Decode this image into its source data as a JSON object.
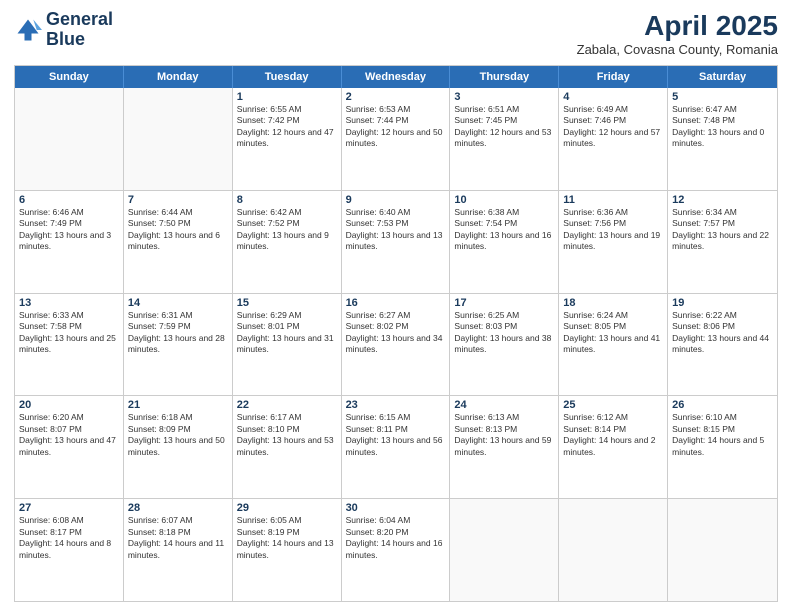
{
  "header": {
    "logo_line1": "General",
    "logo_line2": "Blue",
    "title": "April 2025",
    "subtitle": "Zabala, Covasna County, Romania"
  },
  "weekdays": [
    "Sunday",
    "Monday",
    "Tuesday",
    "Wednesday",
    "Thursday",
    "Friday",
    "Saturday"
  ],
  "rows": [
    [
      {
        "day": "",
        "text": "",
        "empty": true
      },
      {
        "day": "",
        "text": "",
        "empty": true
      },
      {
        "day": "1",
        "text": "Sunrise: 6:55 AM\nSunset: 7:42 PM\nDaylight: 12 hours and 47 minutes."
      },
      {
        "day": "2",
        "text": "Sunrise: 6:53 AM\nSunset: 7:44 PM\nDaylight: 12 hours and 50 minutes."
      },
      {
        "day": "3",
        "text": "Sunrise: 6:51 AM\nSunset: 7:45 PM\nDaylight: 12 hours and 53 minutes."
      },
      {
        "day": "4",
        "text": "Sunrise: 6:49 AM\nSunset: 7:46 PM\nDaylight: 12 hours and 57 minutes."
      },
      {
        "day": "5",
        "text": "Sunrise: 6:47 AM\nSunset: 7:48 PM\nDaylight: 13 hours and 0 minutes."
      }
    ],
    [
      {
        "day": "6",
        "text": "Sunrise: 6:46 AM\nSunset: 7:49 PM\nDaylight: 13 hours and 3 minutes."
      },
      {
        "day": "7",
        "text": "Sunrise: 6:44 AM\nSunset: 7:50 PM\nDaylight: 13 hours and 6 minutes."
      },
      {
        "day": "8",
        "text": "Sunrise: 6:42 AM\nSunset: 7:52 PM\nDaylight: 13 hours and 9 minutes."
      },
      {
        "day": "9",
        "text": "Sunrise: 6:40 AM\nSunset: 7:53 PM\nDaylight: 13 hours and 13 minutes."
      },
      {
        "day": "10",
        "text": "Sunrise: 6:38 AM\nSunset: 7:54 PM\nDaylight: 13 hours and 16 minutes."
      },
      {
        "day": "11",
        "text": "Sunrise: 6:36 AM\nSunset: 7:56 PM\nDaylight: 13 hours and 19 minutes."
      },
      {
        "day": "12",
        "text": "Sunrise: 6:34 AM\nSunset: 7:57 PM\nDaylight: 13 hours and 22 minutes."
      }
    ],
    [
      {
        "day": "13",
        "text": "Sunrise: 6:33 AM\nSunset: 7:58 PM\nDaylight: 13 hours and 25 minutes."
      },
      {
        "day": "14",
        "text": "Sunrise: 6:31 AM\nSunset: 7:59 PM\nDaylight: 13 hours and 28 minutes."
      },
      {
        "day": "15",
        "text": "Sunrise: 6:29 AM\nSunset: 8:01 PM\nDaylight: 13 hours and 31 minutes."
      },
      {
        "day": "16",
        "text": "Sunrise: 6:27 AM\nSunset: 8:02 PM\nDaylight: 13 hours and 34 minutes."
      },
      {
        "day": "17",
        "text": "Sunrise: 6:25 AM\nSunset: 8:03 PM\nDaylight: 13 hours and 38 minutes."
      },
      {
        "day": "18",
        "text": "Sunrise: 6:24 AM\nSunset: 8:05 PM\nDaylight: 13 hours and 41 minutes."
      },
      {
        "day": "19",
        "text": "Sunrise: 6:22 AM\nSunset: 8:06 PM\nDaylight: 13 hours and 44 minutes."
      }
    ],
    [
      {
        "day": "20",
        "text": "Sunrise: 6:20 AM\nSunset: 8:07 PM\nDaylight: 13 hours and 47 minutes."
      },
      {
        "day": "21",
        "text": "Sunrise: 6:18 AM\nSunset: 8:09 PM\nDaylight: 13 hours and 50 minutes."
      },
      {
        "day": "22",
        "text": "Sunrise: 6:17 AM\nSunset: 8:10 PM\nDaylight: 13 hours and 53 minutes."
      },
      {
        "day": "23",
        "text": "Sunrise: 6:15 AM\nSunset: 8:11 PM\nDaylight: 13 hours and 56 minutes."
      },
      {
        "day": "24",
        "text": "Sunrise: 6:13 AM\nSunset: 8:13 PM\nDaylight: 13 hours and 59 minutes."
      },
      {
        "day": "25",
        "text": "Sunrise: 6:12 AM\nSunset: 8:14 PM\nDaylight: 14 hours and 2 minutes."
      },
      {
        "day": "26",
        "text": "Sunrise: 6:10 AM\nSunset: 8:15 PM\nDaylight: 14 hours and 5 minutes."
      }
    ],
    [
      {
        "day": "27",
        "text": "Sunrise: 6:08 AM\nSunset: 8:17 PM\nDaylight: 14 hours and 8 minutes."
      },
      {
        "day": "28",
        "text": "Sunrise: 6:07 AM\nSunset: 8:18 PM\nDaylight: 14 hours and 11 minutes."
      },
      {
        "day": "29",
        "text": "Sunrise: 6:05 AM\nSunset: 8:19 PM\nDaylight: 14 hours and 13 minutes."
      },
      {
        "day": "30",
        "text": "Sunrise: 6:04 AM\nSunset: 8:20 PM\nDaylight: 14 hours and 16 minutes."
      },
      {
        "day": "",
        "text": "",
        "empty": true
      },
      {
        "day": "",
        "text": "",
        "empty": true
      },
      {
        "day": "",
        "text": "",
        "empty": true
      }
    ]
  ]
}
